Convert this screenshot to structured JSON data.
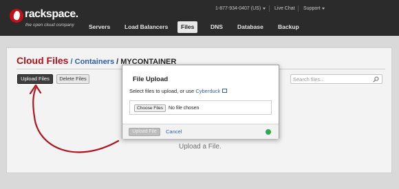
{
  "brand": {
    "name": "rackspace.",
    "tagline": "the open cloud company"
  },
  "utility": {
    "phone": "1-877-934-0407 (US)",
    "live_chat": "Live Chat",
    "support": "Support"
  },
  "nav": {
    "items": [
      {
        "label": "Servers"
      },
      {
        "label": "Load Balancers"
      },
      {
        "label": "Files",
        "active": true
      },
      {
        "label": "DNS"
      },
      {
        "label": "Database"
      },
      {
        "label": "Backup"
      }
    ]
  },
  "page": {
    "title": "Cloud Files",
    "sep1": " / ",
    "breadcrumb_link": "Containers",
    "sep2": " / ",
    "container": "MYCONTAINER"
  },
  "toolbar": {
    "upload_label": "Upload Files",
    "delete_label": "Delete Files"
  },
  "search": {
    "placeholder": "Search files..."
  },
  "empty_state": {
    "text": "Upload a File."
  },
  "dialog": {
    "title": "File Upload",
    "prompt": "Select files to upload, or use ",
    "link": "Cyberduck",
    "choose_label": "Choose Files",
    "file_status": "No file chosen",
    "upload_label": "Upload File",
    "cancel_label": "Cancel"
  },
  "colors": {
    "brand_red": "#c40f18",
    "title_red": "#b3101b",
    "link_blue": "#2a5fb0",
    "arrow_red": "#b0141c",
    "status_green": "#2ea84a"
  },
  "icons": {
    "search": "search-icon",
    "external": "external-link-icon",
    "status": "spinner-icon"
  }
}
